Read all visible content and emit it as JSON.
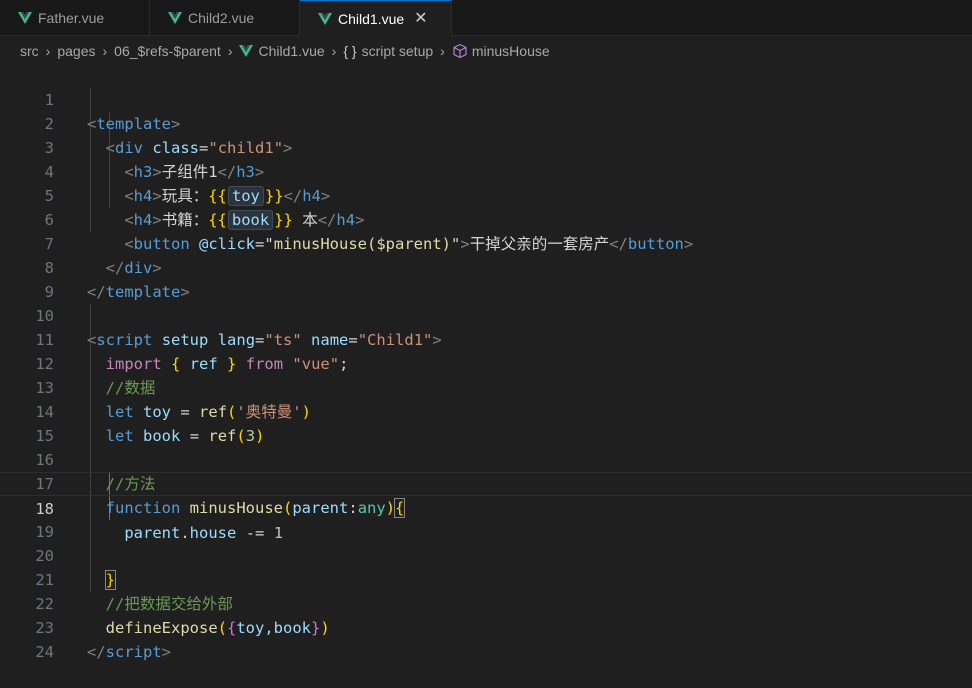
{
  "tabs": [
    {
      "label": "Father.vue",
      "active": false
    },
    {
      "label": "Child2.vue",
      "active": false
    },
    {
      "label": "Child1.vue",
      "active": true
    }
  ],
  "tab_close_glyph": "✕",
  "breadcrumb": {
    "items": [
      "src",
      "pages",
      "06_$refs-$parent",
      "Child1.vue",
      "script setup",
      "minusHouse"
    ],
    "separator": "›",
    "braces": "{ }"
  },
  "colors": {
    "vue_green": "#42b883",
    "vue_dark": "#35495e",
    "background": "#1f1f1f",
    "active_tab_border": "#0078d4"
  },
  "icons": {
    "file": "vue-file-icon",
    "scope": "braces-icon",
    "method": "cube-icon"
  },
  "editor": {
    "current_line": 18,
    "line_numbers": [
      "1",
      "2",
      "3",
      "4",
      "5",
      "6",
      "7",
      "8",
      "9",
      "10",
      "11",
      "12",
      "13",
      "14",
      "15",
      "16",
      "17",
      "18",
      "19",
      "20",
      "21",
      "22",
      "23",
      "24"
    ],
    "t": {
      "template": "template",
      "div": "div",
      "class_attr": "class",
      "child1_str": "\"child1\"",
      "h3": "h3",
      "h4": "h4",
      "sub_component": "子组件1",
      "toy_label": "玩具：",
      "book_label": "书籍：",
      "open_mustache": "{{",
      "close_mustache": "}}",
      "toy": "toy",
      "book": "book",
      "ben": " 本",
      "button": "button",
      "click_attr": "@click",
      "minus_call": "minusHouse($parent)",
      "button_text": "干掉父亲的一套房产",
      "script": "script",
      "setup_attr": "setup",
      "lang_attr": "lang",
      "ts_str": "\"ts\"",
      "name_attr": "name",
      "child1_name_str": "\"Child1\"",
      "import_kw": "import",
      "ref": "ref",
      "from_kw": "from",
      "vue_str": "\"vue\"",
      "comment_data": "//数据",
      "let_kw": "let",
      "ultraman_str": "'奥特曼'",
      "three": "3",
      "comment_method": "//方法",
      "function_kw": "function",
      "minus_fn": "minusHouse",
      "parent": "parent",
      "any_type": "any",
      "house": "house",
      "minus_eq": "-=",
      "one": "1",
      "comment_expose": "//把数据交给外部",
      "define_expose": "defineExpose",
      "toy_book": "toy,book"
    }
  }
}
